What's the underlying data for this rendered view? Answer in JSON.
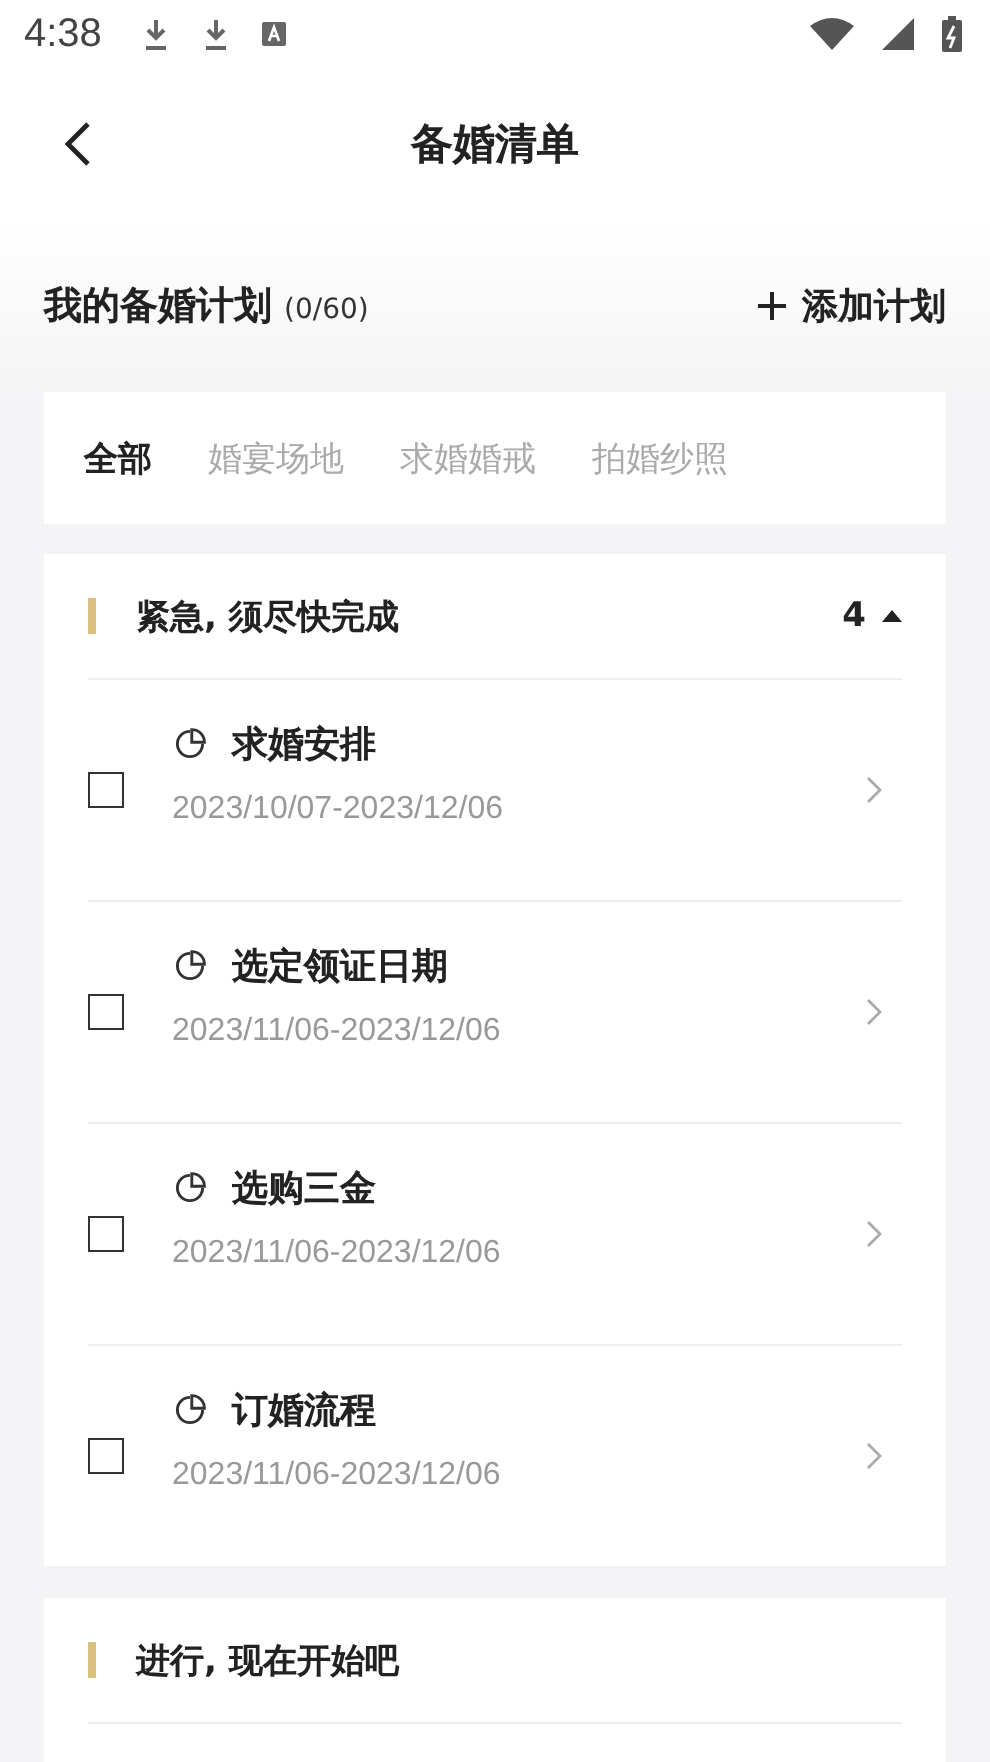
{
  "status_bar": {
    "time": "4:38"
  },
  "header": {
    "title": "备婚清单"
  },
  "plan": {
    "title": "我的备婚计划",
    "count": "(0/60)",
    "add_label": "添加计划"
  },
  "tabs": [
    {
      "label": "全部",
      "selected": true
    },
    {
      "label": "婚宴场地",
      "selected": false
    },
    {
      "label": "求婚婚戒",
      "selected": false
    },
    {
      "label": "拍婚纱照",
      "selected": false
    }
  ],
  "sections": [
    {
      "title": "紧急, 须尽快完成",
      "count": "4",
      "expanded": true,
      "items": [
        {
          "title": "求婚安排",
          "dates": "2023/10/07-2023/12/06",
          "checked": false
        },
        {
          "title": "选定领证日期",
          "dates": "2023/11/06-2023/12/06",
          "checked": false
        },
        {
          "title": "选购三金",
          "dates": "2023/11/06-2023/12/06",
          "checked": false
        },
        {
          "title": "订婚流程",
          "dates": "2023/11/06-2023/12/06",
          "checked": false
        }
      ]
    },
    {
      "title": "进行, 现在开始吧"
    }
  ]
}
